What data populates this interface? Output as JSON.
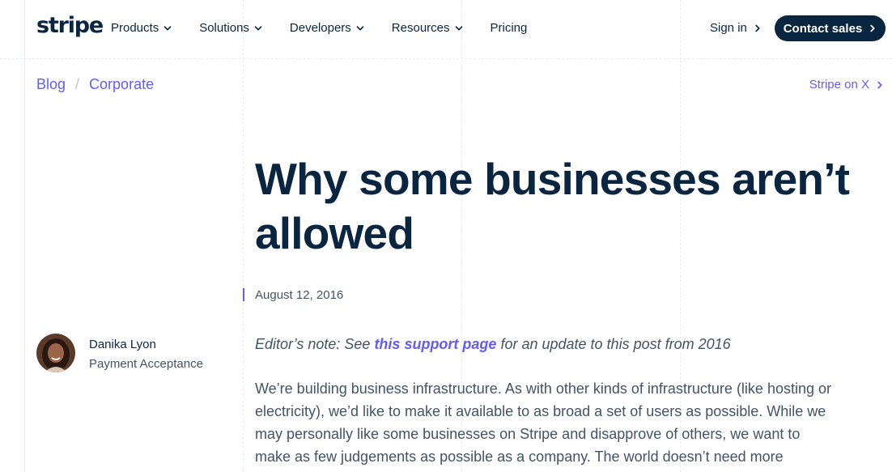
{
  "header": {
    "logo": "stripe",
    "nav": [
      {
        "label": "Products",
        "has_dropdown": true
      },
      {
        "label": "Solutions",
        "has_dropdown": true
      },
      {
        "label": "Developers",
        "has_dropdown": true
      },
      {
        "label": "Resources",
        "has_dropdown": true
      },
      {
        "label": "Pricing",
        "has_dropdown": false
      }
    ],
    "sign_in": "Sign in",
    "contact_sales": "Contact sales"
  },
  "breadcrumb": {
    "items": [
      "Blog",
      "Corporate"
    ],
    "separator": "/"
  },
  "social_link": "Stripe on X",
  "article": {
    "title": "Why some businesses aren’t allowed",
    "date": "August 12, 2016",
    "author": {
      "name": "Danika Lyon",
      "role": "Payment Acceptance"
    },
    "editor_note": {
      "prefix": "Editor’s note: See ",
      "link": "this support page",
      "suffix": " for an update to this post from 2016"
    },
    "body": "We’re building business infrastructure. As with other kinds of infrastructure (like hosting or electricity), we’d like to make it available to as broad a set of users as possible. While we may personally like some businesses on Stripe and disapprove of others, we want to make as few judgements as possible as a company. The world doesn’t need more"
  },
  "colors": {
    "primary_text": "#0a2540",
    "body_text": "#425466",
    "accent": "#635bff",
    "button_bg": "#0a2540"
  },
  "icons": [
    "chevron-down-icon",
    "chevron-right-icon"
  ]
}
